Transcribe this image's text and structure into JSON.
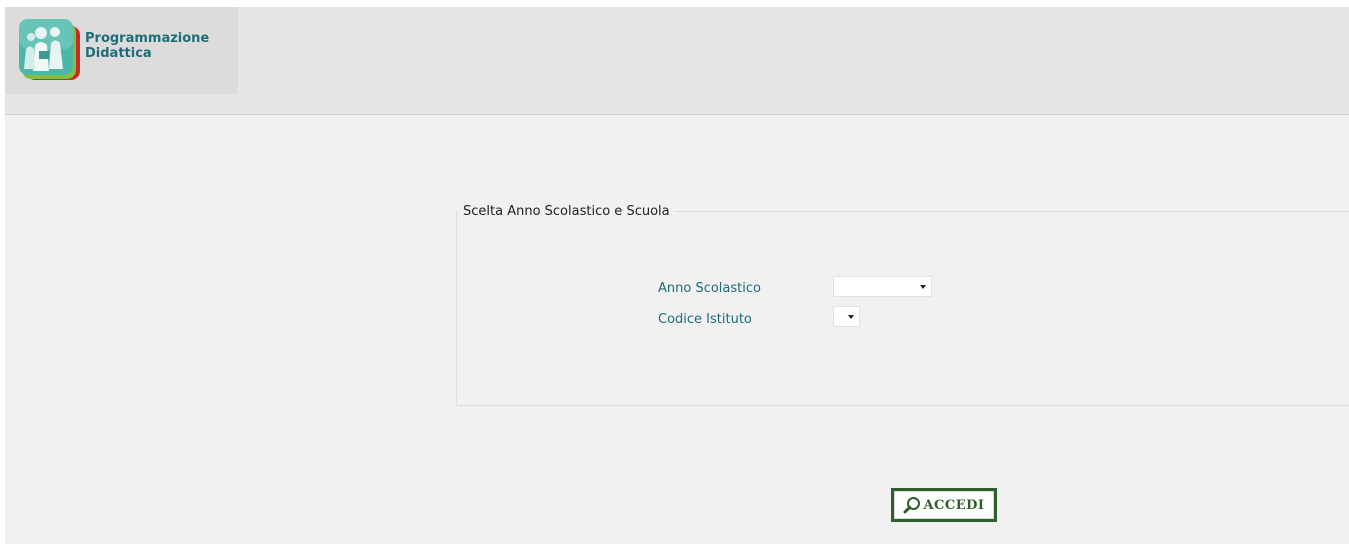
{
  "header": {
    "app_title_line1": "Programmazione",
    "app_title_line2": "Didattica",
    "logo_icon": "people-group-icon"
  },
  "form": {
    "legend": "Scelta Anno Scolastico e Scuola",
    "fields": [
      {
        "label": "Anno Scolastico",
        "value": ""
      },
      {
        "label": "Codice Istituto",
        "value": ""
      }
    ]
  },
  "actions": {
    "accedi_label": "ACCEDI",
    "accedi_icon": "search-icon"
  },
  "colors": {
    "label": "#1e6b78",
    "button_border": "#2f5f2f",
    "header_bg": "#e6e6e6",
    "page_bg": "#f1f1f1"
  }
}
